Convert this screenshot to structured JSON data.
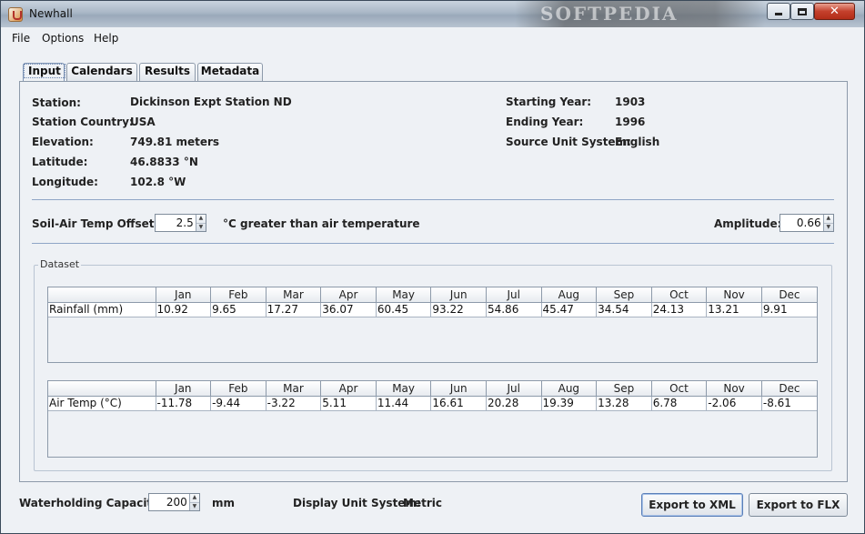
{
  "window": {
    "title": "Newhall",
    "watermark": "SOFTPEDIA"
  },
  "menu": [
    "File",
    "Options",
    "Help"
  ],
  "tabs": [
    "Input",
    "Calendars",
    "Results",
    "Metadata"
  ],
  "station_info": {
    "station_label": "Station:",
    "station": "Dickinson Expt Station ND",
    "country_label": "Station Country:",
    "country": "USA",
    "elevation_label": "Elevation:",
    "elevation": "749.81 meters",
    "latitude_label": "Latitude:",
    "latitude": "46.8833 °N",
    "longitude_label": "Longitude:",
    "longitude": "102.8 °W",
    "start_year_label": "Starting Year:",
    "start_year": "1903",
    "end_year_label": "Ending Year:",
    "end_year": "1996",
    "unit_system_label": "Source Unit System:",
    "unit_system": "English"
  },
  "offset": {
    "label": "Soil-Air Temp Offset:",
    "value": "2.5",
    "suffix": "°C  greater than air temperature"
  },
  "amplitude": {
    "label": "Amplitude:",
    "value": "0.66"
  },
  "dataset": {
    "title": "Dataset",
    "months": [
      "Jan",
      "Feb",
      "Mar",
      "Apr",
      "May",
      "Jun",
      "Jul",
      "Aug",
      "Sep",
      "Oct",
      "Nov",
      "Dec"
    ],
    "rainfall": {
      "label": "Rainfall (mm)",
      "values": [
        "10.92",
        "9.65",
        "17.27",
        "36.07",
        "60.45",
        "93.22",
        "54.86",
        "45.47",
        "34.54",
        "24.13",
        "13.21",
        "9.91"
      ]
    },
    "air_temp": {
      "label": "Air Temp (°C)",
      "values": [
        "-11.78",
        "-9.44",
        "-3.22",
        "5.11",
        "11.44",
        "16.61",
        "20.28",
        "19.39",
        "13.28",
        "6.78",
        "-2.06",
        "-8.61"
      ]
    }
  },
  "bottom": {
    "waterholding_label": "Waterholding Capacity:",
    "waterholding_value": "200",
    "waterholding_unit": "mm",
    "display_unit_label": "Display Unit System:",
    "display_unit": "Metric",
    "export_xml": "Export to XML",
    "export_flx": "Export to FLX"
  }
}
